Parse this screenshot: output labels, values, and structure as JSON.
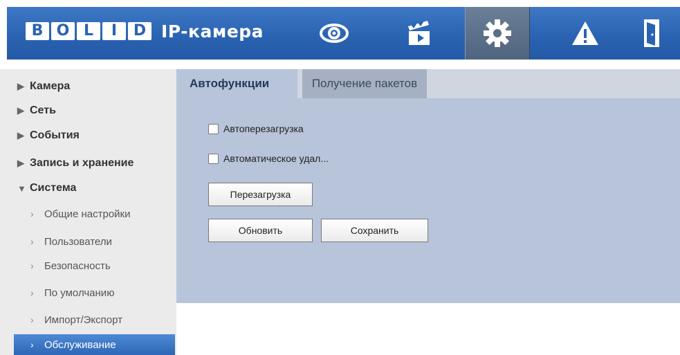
{
  "header": {
    "logo_letters": [
      "B",
      "O",
      "L",
      "I",
      "D"
    ],
    "product_name": "IP-камера",
    "nav": [
      {
        "icon": "eye-icon",
        "label": "Live"
      },
      {
        "icon": "clapperboard-icon",
        "label": "Playback"
      },
      {
        "icon": "gear-icon",
        "label": "Setup",
        "active": true
      },
      {
        "icon": "warning-icon",
        "label": "Alarm"
      },
      {
        "icon": "exit-door-icon",
        "label": "Logout"
      }
    ]
  },
  "sidebar": {
    "items": [
      {
        "label": "Камера",
        "expanded": false
      },
      {
        "label": "Сеть",
        "expanded": false
      },
      {
        "label": "События",
        "expanded": false
      },
      {
        "label": "Запись и хранение",
        "expanded": false
      },
      {
        "label": "Система",
        "expanded": true
      }
    ],
    "sub_items": [
      {
        "label": "Общие настройки"
      },
      {
        "label": "Пользователи"
      },
      {
        "label": "Безопасность"
      },
      {
        "label": "По умолчанию"
      },
      {
        "label": "Импорт/Экспорт"
      },
      {
        "label": "Обслуживание",
        "active": true
      }
    ]
  },
  "tabs": [
    {
      "label": "Автофункции",
      "active": true
    },
    {
      "label": "Получение пакетов",
      "active": false
    }
  ],
  "form": {
    "auto_reboot_label": "Автоперезагрузка",
    "auto_reboot_checked": false,
    "auto_delete_label": "Автоматическое удал...",
    "auto_delete_checked": false,
    "reboot_button": "Перезагрузка",
    "refresh_button": "Обновить",
    "save_button": "Сохранить"
  },
  "colors": {
    "header_blue": "#2a63b2",
    "panel": "#b7c4d9",
    "active_menu": "#2c66b5"
  }
}
